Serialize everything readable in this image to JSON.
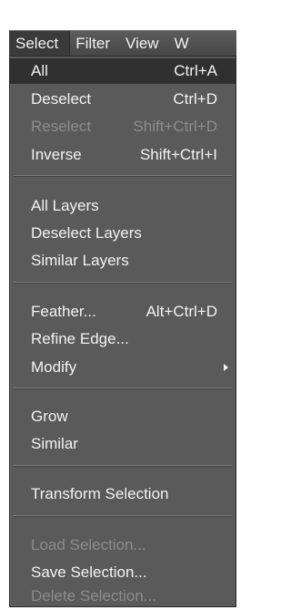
{
  "menubar": {
    "items": [
      "Select",
      "Filter",
      "View",
      "W"
    ]
  },
  "menu": {
    "items": [
      {
        "label": "All",
        "shortcut": "Ctrl+A"
      },
      {
        "label": "Deselect",
        "shortcut": "Ctrl+D"
      },
      {
        "label": "Reselect",
        "shortcut": "Shift+Ctrl+D"
      },
      {
        "label": "Inverse",
        "shortcut": "Shift+Ctrl+I"
      },
      {
        "label": "All Layers",
        "shortcut": ""
      },
      {
        "label": "Deselect Layers",
        "shortcut": ""
      },
      {
        "label": "Similar Layers",
        "shortcut": ""
      },
      {
        "label": "Feather...",
        "shortcut": "Alt+Ctrl+D"
      },
      {
        "label": "Refine Edge...",
        "shortcut": ""
      },
      {
        "label": "Modify",
        "shortcut": ""
      },
      {
        "label": "Grow",
        "shortcut": ""
      },
      {
        "label": "Similar",
        "shortcut": ""
      },
      {
        "label": "Transform Selection",
        "shortcut": ""
      },
      {
        "label": "Load Selection...",
        "shortcut": ""
      },
      {
        "label": "Save Selection...",
        "shortcut": ""
      },
      {
        "label": "Delete Selection...",
        "shortcut": ""
      }
    ]
  }
}
